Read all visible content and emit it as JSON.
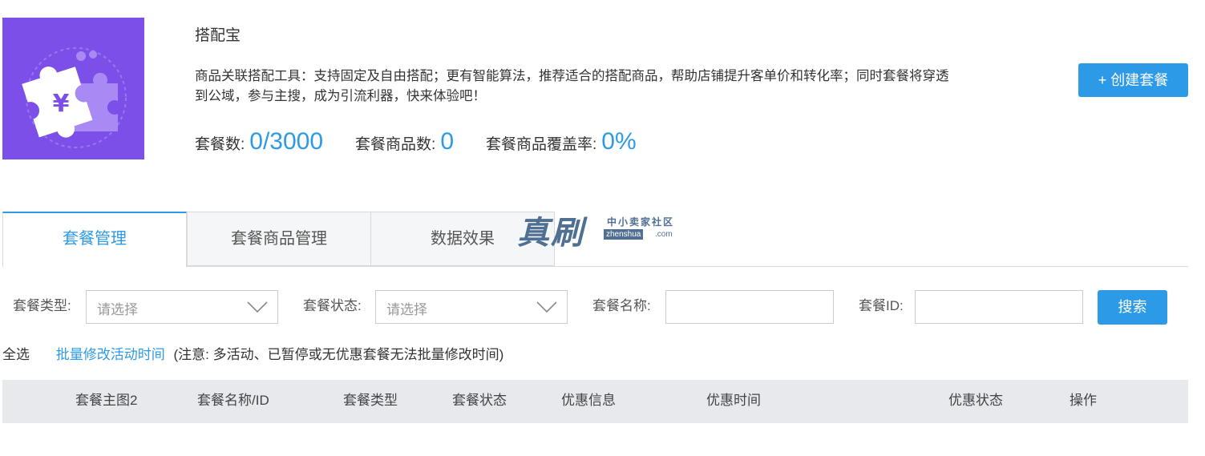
{
  "app": {
    "title": "搭配宝",
    "description": "商品关联搭配工具：支持固定及自由搭配；更有智能算法，推荐适合的搭配商品，帮助店铺提升客单价和转化率；同时套餐将穿透到公域，参与主搜，成为引流利器，快来体验吧！",
    "icon": "puzzle-yen-icon",
    "icon_bg_color": "#7b4fe8"
  },
  "stats": [
    {
      "label": "套餐数:",
      "value": "0/3000"
    },
    {
      "label": "套餐商品数:",
      "value": "0"
    },
    {
      "label": "套餐商品覆盖率:",
      "value": "0%"
    }
  ],
  "create_button": {
    "label": "+ 创建套餐"
  },
  "tabs": [
    {
      "label": "套餐管理",
      "active": true
    },
    {
      "label": "套餐商品管理",
      "active": false
    },
    {
      "label": "数据效果",
      "active": false
    }
  ],
  "watermark": {
    "main": "真刷",
    "sub": "中小卖家社区",
    "domain_box": "zhenshua",
    "domain_tld": ".com"
  },
  "filters": {
    "type_label": "套餐类型:",
    "type_placeholder": "请选择",
    "status_label": "套餐状态:",
    "status_placeholder": "请选择",
    "name_label": "套餐名称:",
    "name_value": "",
    "id_label": "套餐ID:",
    "id_value": "",
    "search_label": "搜索"
  },
  "batch": {
    "select_all": "全选",
    "link": "批量修改活动时间",
    "note": "(注意: 多活动、已暂停或无优惠套餐无法批量修改时间)"
  },
  "table": {
    "columns": [
      "套餐主图2",
      "套餐名称/ID",
      "套餐类型",
      "套餐状态",
      "优惠信息",
      "优惠时间",
      "优惠状态",
      "操作"
    ]
  },
  "colors": {
    "accent": "#2d9ae8",
    "header_bg": "#e8e9ec"
  }
}
